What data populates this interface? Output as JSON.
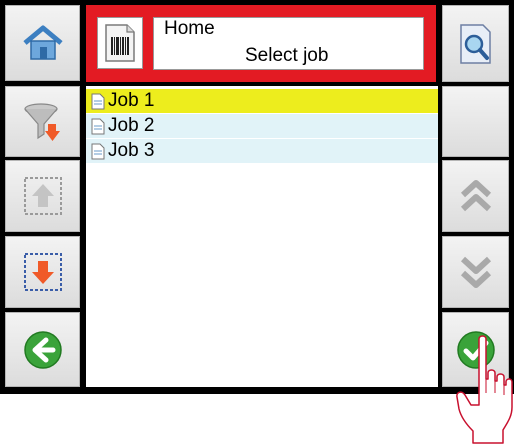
{
  "header": {
    "location": "Home",
    "title": "Select job"
  },
  "jobs": [
    {
      "label": "Job 1",
      "selected": true
    },
    {
      "label": "Job 2",
      "selected": false
    },
    {
      "label": "Job 3",
      "selected": false
    }
  ],
  "left_buttons": [
    "home-icon",
    "filter-icon",
    "import-icon",
    "export-icon",
    "back-icon"
  ],
  "right_buttons": [
    "preview-icon",
    "scroll-up-icon",
    "scroll-down-icon",
    "confirm-icon"
  ],
  "colors": {
    "header_border": "#e31b23",
    "selected_row": "#eded1d",
    "alt_row": "#e1f3f8",
    "confirm": "#3aa33a",
    "back": "#3aa33a"
  }
}
